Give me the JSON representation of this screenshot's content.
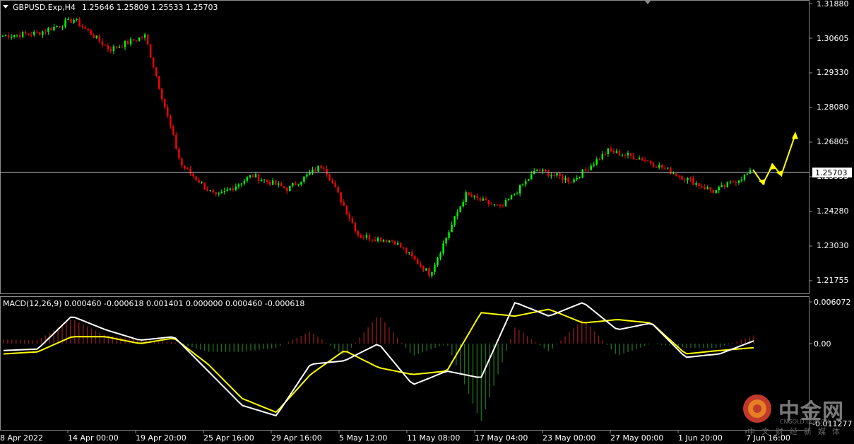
{
  "chart_header": {
    "symbol_timeframe": "GBPUSD.Exp,H4",
    "ohlc": "1.25646 1.25809 1.25533 1.25703"
  },
  "indicator_header": {
    "label": "MACD(12,26,9) 0.000460 -0.000618 0.001401 0.000000 0.000460 -0.000618"
  },
  "price_axis": {
    "ticks": [
      "1.31880",
      "1.30605",
      "1.29330",
      "1.28080",
      "1.26805",
      "1.25555",
      "1.24280",
      "1.23030",
      "1.21755"
    ],
    "current_price": "1.25703"
  },
  "macd_axis": {
    "ticks": [
      "0.006072",
      "0.00",
      "-0.011277"
    ]
  },
  "time_axis": {
    "labels": [
      "8 Apr 2022",
      "14 Apr 00:00",
      "19 Apr 20:00",
      "25 Apr 16:00",
      "29 Apr 16:00",
      "5 May 12:00",
      "11 May 08:00",
      "17 May 04:00",
      "23 May 00:00",
      "27 May 00:00",
      "1 Jun 20:00",
      "7 Jun 16:00"
    ]
  },
  "colors": {
    "background": "#000000",
    "bull": "#00ff00",
    "bear": "#ff0000",
    "macd_line": "#ffffff",
    "signal_line": "#ffff00",
    "hist_pos": "#8b1a1a",
    "hist_neg": "#1f6b1f",
    "current_price_line": "#c0c0c0",
    "annotation_arrow": "#ffff00"
  },
  "watermark": {
    "brand": "中金网",
    "domain": "CNGOLD.COM.CN",
    "subtitle": "中文财经新媒体"
  },
  "chart_data": {
    "type": "candlestick",
    "symbol": "GBPUSD.Exp",
    "timeframe": "H4",
    "close_path": [
      [
        "8 Apr 2022",
        1.307
      ],
      [
        "14 Apr 00:00",
        1.308
      ],
      [
        "14 Apr 00:00",
        1.313
      ],
      [
        "19 Apr 20:00",
        1.302
      ],
      [
        "19 Apr 20:00",
        1.307
      ],
      [
        "25 Apr 16:00",
        1.26
      ],
      [
        "25 Apr 16:00",
        1.248
      ],
      [
        "29 Apr 16:00",
        1.256
      ],
      [
        "29 Apr 16:00",
        1.251
      ],
      [
        "5 May 12:00",
        1.26
      ],
      [
        "5 May 12:00",
        1.234
      ],
      [
        "11 May 08:00",
        1.232
      ],
      [
        "11 May 08:00",
        1.22
      ],
      [
        "17 May 04:00",
        1.249
      ],
      [
        "17 May 04:00",
        1.244
      ],
      [
        "23 May 00:00",
        1.258
      ],
      [
        "23 May 00:00",
        1.254
      ],
      [
        "27 May 00:00",
        1.265
      ],
      [
        "27 May 00:00",
        1.262
      ],
      [
        "1 Jun 20:00",
        1.256
      ],
      [
        "1 Jun 20:00",
        1.25
      ],
      [
        "7 Jun 16:00",
        1.257
      ]
    ],
    "macd_main_path": [
      -0.001,
      -0.0008,
      0.004,
      0.002,
      0.0005,
      0.001,
      -0.004,
      -0.009,
      -0.0105,
      -0.003,
      -0.0025,
      0.0,
      -0.006,
      -0.004,
      -0.005,
      0.006,
      0.004,
      0.006,
      0.002,
      0.003,
      -0.002,
      -0.0015,
      0.0004
    ],
    "signal_path": [
      -0.0015,
      -0.0012,
      0.001,
      0.001,
      0.0,
      0.0008,
      -0.003,
      -0.008,
      -0.01,
      -0.0045,
      -0.001,
      -0.0035,
      -0.0045,
      -0.004,
      0.0045,
      0.004,
      0.005,
      0.003,
      0.0035,
      0.003,
      -0.0015,
      -0.001,
      -0.0006
    ],
    "macd_current": {
      "macd": 0.00046,
      "signal": -0.000618,
      "hist": 0.001401
    },
    "ylim_price": [
      1.213,
      1.32
    ],
    "ylim_macd": [
      -0.0118,
      0.0065
    ],
    "annotations": [
      "projected zig-zag arrow up from current price"
    ]
  }
}
